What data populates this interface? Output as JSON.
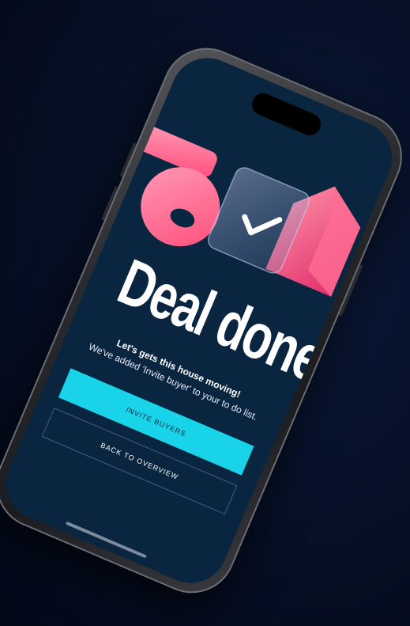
{
  "screen": {
    "headline": "Deal done",
    "subtitle": "Let's gets this house moving!",
    "body": "We've added 'Invite buyer' to your to do list."
  },
  "actions": {
    "primary_label": "INVITE BUYERS",
    "secondary_label": "BACK TO OVERVIEW"
  },
  "illustration": {
    "icons": [
      "key-icon",
      "checkmark-card-icon",
      "house-icon"
    ]
  },
  "colors": {
    "screen_background": "#0a2540",
    "primary_button": "#19d3e8",
    "accent_pink": "#ff5e86",
    "page_background": "#050a1c"
  }
}
